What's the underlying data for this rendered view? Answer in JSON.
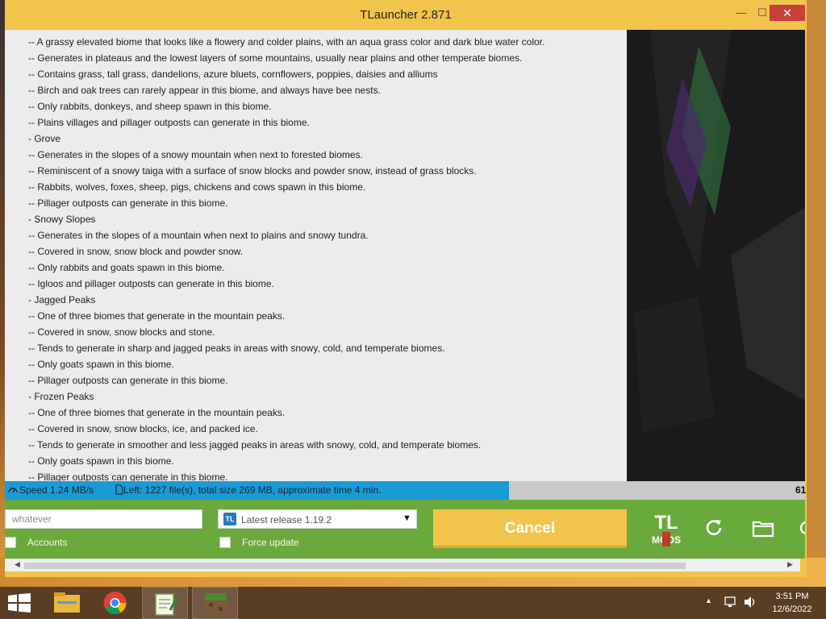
{
  "window": {
    "title": "TLauncher 2.871",
    "minimize_glyph": "—",
    "maximize_glyph": "☐",
    "close_glyph": "✕"
  },
  "news": {
    "lines": [
      "-- A grassy elevated biome that looks like a flowery and colder plains, with an aqua grass color and dark blue water color.",
      "-- Generates in plateaus and the lowest layers of some mountains, usually near plains and other temperate biomes.",
      "-- Contains grass, tall grass, dandelions, azure bluets, cornflowers, poppies, daisies and alliums",
      "-- Birch and oak trees can rarely appear in this biome, and always have bee nests.",
      "-- Only rabbits, donkeys, and sheep spawn in this biome.",
      "-- Plains villages and pillager outposts can generate in this biome.",
      "- Grove",
      "-- Generates in the slopes of a snowy mountain when next to forested biomes.",
      "-- Reminiscent of a snowy taiga with a surface of snow blocks and powder snow, instead of grass blocks.",
      "-- Rabbits, wolves, foxes, sheep, pigs, chickens and cows spawn in this biome.",
      "-- Pillager outposts can generate in this biome.",
      "- Snowy Slopes",
      "-- Generates in the slopes of a mountain when next to plains and snowy tundra.",
      "-- Covered in snow, snow block and powder snow.",
      "-- Only rabbits and goats spawn in this biome.",
      "-- Igloos and pillager outposts can generate in this biome.",
      "- Jagged Peaks",
      "-- One of three biomes that generate in the mountain peaks.",
      "-- Covered in snow, snow blocks and stone.",
      "-- Tends to generate in sharp and jagged peaks in areas with snowy, cold, and temperate biomes.",
      "-- Only goats spawn in this biome.",
      "-- Pillager outposts can generate in this biome.",
      "- Frozen Peaks",
      "-- One of three biomes that generate in the mountain peaks.",
      "-- Covered in snow, snow blocks, ice, and packed ice.",
      "-- Tends to generate in smoother and less jagged peaks in areas with snowy, cold, and temperate biomes.",
      "-- Only goats spawn in this biome.",
      "-- Pillager outposts can generate in this biome."
    ]
  },
  "progress": {
    "speed": "Speed 1.24 MB/s",
    "left": "Left: 1227 file(s), total size 269 MB, approximate time 4 min.",
    "percent_text": "61",
    "fraction": 0.63
  },
  "controls": {
    "username_value": "whatever",
    "accounts_label": "Accounts",
    "version_value": "Latest release 1.19.2",
    "force_update_label": "Force update",
    "cancel_label": "Cancel",
    "version_icon_text": "TL"
  },
  "taskbar": {
    "time": "3:51 PM",
    "date": "12/6/2022"
  },
  "colors": {
    "accent_yellow": "#f1c44b",
    "panel_green": "#6aaa3c",
    "progress_blue": "#1a9ad6"
  }
}
